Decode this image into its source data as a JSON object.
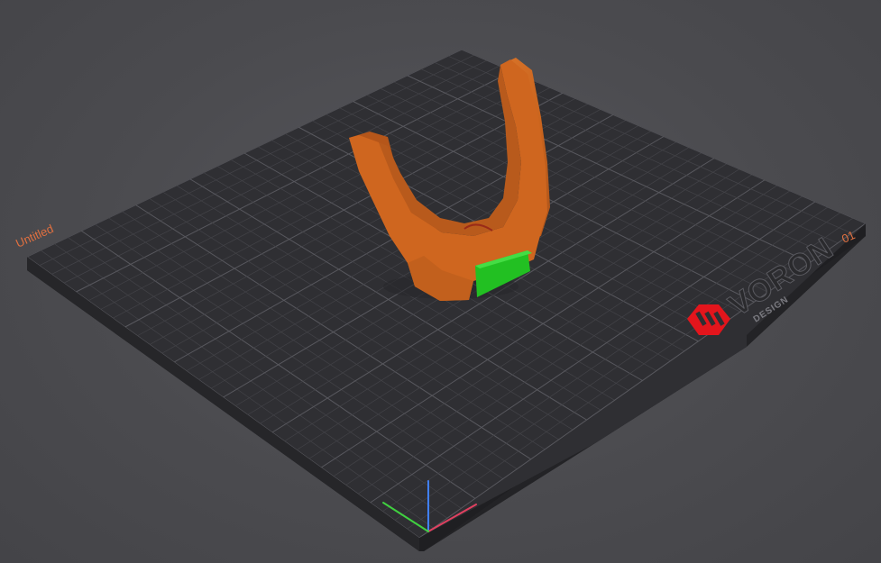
{
  "viewport": {
    "plate_name": "Untitled",
    "plate_number": "01"
  },
  "bed_logo": {
    "word": "VORON",
    "subword": "DESIGN"
  },
  "colors": {
    "background": "#4a4a4e",
    "bed_top": "#2f2f33",
    "bed_edge": "#232326",
    "grid_line": "#4b4b50",
    "model_orange": "#d2691e",
    "model_orange_dark": "#b5561a",
    "selected_face_green": "#22c022",
    "logo_red": "#e3151c",
    "label_orange": "#e07040",
    "axis_x": "#e04060",
    "axis_y": "#40d040",
    "axis_z": "#4080ff"
  },
  "icons": {
    "axes": "xyz-axes-gizmo-icon",
    "logo": "voron-logo-icon"
  }
}
